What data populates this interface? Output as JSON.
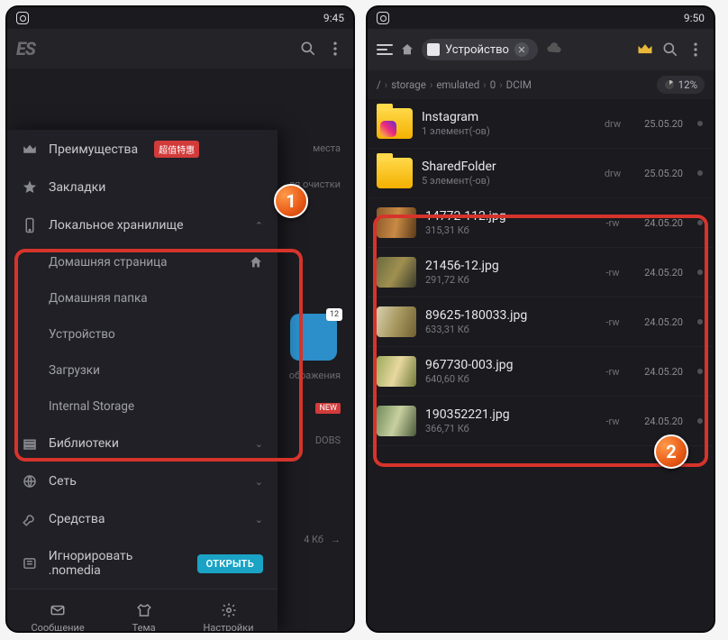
{
  "left": {
    "status_time": "9:45",
    "logo": "ES",
    "hint_top": "места",
    "hint_clean": "ля очистки",
    "sidebar": {
      "premium": "Преимущества",
      "premium_badge": "超值特惠",
      "bookmarks": "Закладки",
      "local_storage": "Локальное хранилище",
      "items": [
        "Домашняя страница",
        "Домашняя папка",
        "Устройство",
        "Загрузки",
        "Internal Storage"
      ],
      "libraries": "Библиотеки",
      "network": "Сеть",
      "tools": "Средства",
      "nomedia": "Игнорировать .nomedia",
      "open_btn": "ОТКРЫТЬ"
    },
    "bottom": {
      "message": "Сообщение",
      "theme": "Тема",
      "settings": "Настройки"
    },
    "under": {
      "img_label": "ображения",
      "tile_count": "12",
      "new_badge": "NEW",
      "dobs": "DOBS",
      "size_hint": "4 Кб"
    },
    "marker1": "1"
  },
  "right": {
    "status_time": "9:50",
    "chip_label": "Устройство",
    "breadcrumb": [
      "/",
      "storage",
      "emulated",
      "0",
      "DCIM"
    ],
    "usage": "12%",
    "folders": [
      {
        "name": "Instagram",
        "meta": "1 элемент(-ов)",
        "perm": "drw",
        "date": "25.05.20"
      },
      {
        "name": "SharedFolder",
        "meta": "5 элемент(-ов)",
        "perm": "drw",
        "date": "25.05.20"
      }
    ],
    "files": [
      {
        "name": "14772-112.jpg",
        "meta": "315,31 Кб",
        "perm": "-rw",
        "date": "24.05.20"
      },
      {
        "name": "21456-12.jpg",
        "meta": "291,72 Кб",
        "perm": "-rw",
        "date": "24.05.20"
      },
      {
        "name": "89625-180033.jpg",
        "meta": "633,31 Кб",
        "perm": "-rw",
        "date": "24.05.20"
      },
      {
        "name": "967730-003.jpg",
        "meta": "640,60 Кб",
        "perm": "-rw",
        "date": "24.05.20"
      },
      {
        "name": "190352221.jpg",
        "meta": "366,71 Кб",
        "perm": "-rw",
        "date": "24.05.20"
      }
    ],
    "marker2": "2"
  }
}
